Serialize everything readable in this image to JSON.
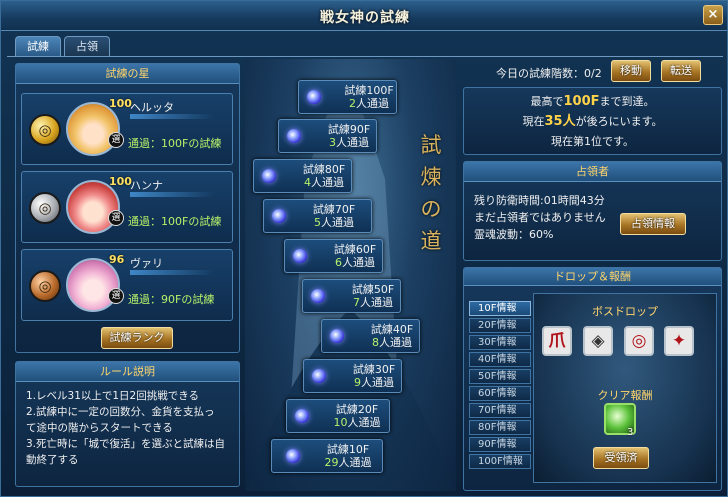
{
  "window": {
    "title": "戦女神の試練",
    "close_label": "×"
  },
  "tabs": [
    {
      "label": "試練"
    },
    {
      "label": "占領"
    }
  ],
  "stars": {
    "header": "試練の星",
    "heroes": [
      {
        "level": "100",
        "name": "ヘルッタ",
        "select": "選",
        "progress": "通過：100Fの試練",
        "medal": "gold"
      },
      {
        "level": "100",
        "name": "ハンナ",
        "select": "選",
        "progress": "通過：100Fの試練",
        "medal": "silver"
      },
      {
        "level": "96",
        "name": "ヴァリ",
        "select": "選",
        "progress": "通過：90Fの試練",
        "medal": "bronze"
      }
    ],
    "ranking_button": "試練ランク"
  },
  "rules": {
    "header": "ルール説明",
    "lines": [
      "1.レベル31以上で1日2回挑戦できる",
      "2.試練中に一定の回数分、金貨を支払っ",
      "て途中の階からスタートできる",
      "3.死亡時に「城で復活」を選ぶと試練は自",
      "動終了する"
    ]
  },
  "tower": {
    "road_text": [
      "試",
      "煉",
      "の",
      "道"
    ],
    "floors": [
      {
        "name": "試練100F",
        "count": "2",
        "suffix": "人通過"
      },
      {
        "name": "試練90F",
        "count": "3",
        "suffix": "人通過"
      },
      {
        "name": "試練80F",
        "count": "4",
        "suffix": "人通過"
      },
      {
        "name": "試練70F",
        "count": "5",
        "suffix": "人通過"
      },
      {
        "name": "試練60F",
        "count": "6",
        "suffix": "人通過"
      },
      {
        "name": "試練50F",
        "count": "7",
        "suffix": "人通過"
      },
      {
        "name": "試練40F",
        "count": "8",
        "suffix": "人通過"
      },
      {
        "name": "試練30F",
        "count": "9",
        "suffix": "人通過"
      },
      {
        "name": "試練20F",
        "count": "10",
        "suffix": "人通過"
      },
      {
        "name": "試練10F",
        "count": "29",
        "suffix": "人通過"
      }
    ]
  },
  "today": {
    "label": "今日の試練階数：",
    "value": "0/2",
    "move_button": "移動",
    "transfer_button": "転送"
  },
  "record": {
    "line1_pre": "最高で",
    "line1_hl": "100F",
    "line1_post": "まで到達。",
    "line2_pre": "現在",
    "line2_hl": "35人",
    "line2_post": "が後ろにいます。",
    "line3": "現在第1位です。"
  },
  "occupant": {
    "header": "占領者",
    "time": "残り防衛時間:01時間43分",
    "status": "まだ占領者ではありません",
    "spirit": "霊魂波動：60%",
    "info_button": "占領情報"
  },
  "drops": {
    "header": "ドロップ＆報酬",
    "floor_tabs": [
      "10F情報",
      "20F情報",
      "30F情報",
      "40F情報",
      "50F情報",
      "60F情報",
      "70F情報",
      "80F情報",
      "90F情報",
      "100F情報"
    ],
    "active_tab": 0,
    "boss_drop_label": "ボスドロップ",
    "clear_reward_label": "クリア報酬",
    "reward_count": "3",
    "claimed_button": "受領済"
  },
  "colors": {
    "accent": "#ffd56b",
    "pass_green": "#b6f06a",
    "highlight": "#ffd24a"
  }
}
